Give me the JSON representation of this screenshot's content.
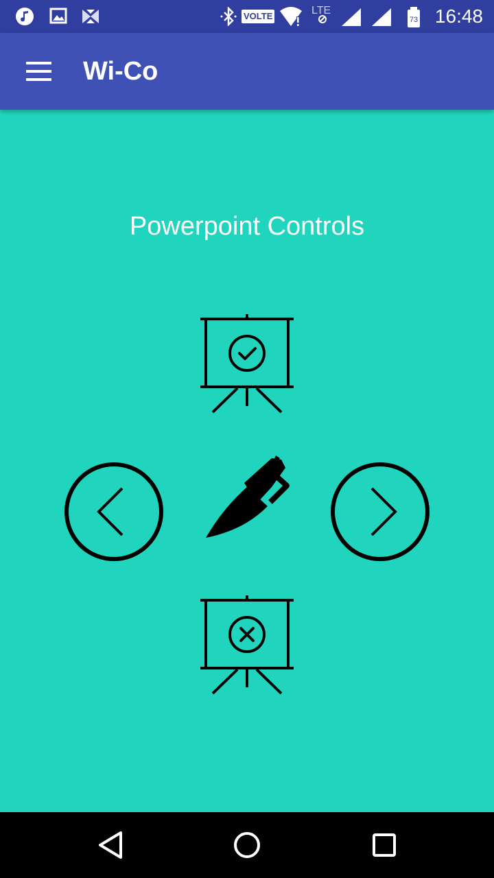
{
  "status_bar": {
    "time": "16:48",
    "volte_label": "VOLTE",
    "battery_level": "73",
    "icons": [
      "music-icon",
      "gallery-icon",
      "app-notification-icon",
      "bluetooth-icon",
      "volte-icon",
      "wifi-icon",
      "lte-icon",
      "signal-icon",
      "signal-icon",
      "battery-icon"
    ]
  },
  "app_bar": {
    "title": "Wi-Co",
    "menu_icon": "hamburger-menu-icon"
  },
  "main": {
    "heading": "Powerpoint Controls",
    "controls": [
      {
        "name": "start-presentation",
        "icon": "presentation-check-icon"
      },
      {
        "name": "previous-slide",
        "icon": "chevron-left-circle-icon"
      },
      {
        "name": "pen-tool",
        "icon": "pen-icon"
      },
      {
        "name": "next-slide",
        "icon": "chevron-right-circle-icon"
      },
      {
        "name": "stop-presentation",
        "icon": "presentation-close-icon"
      }
    ]
  },
  "nav_bar": {
    "buttons": [
      "back-icon",
      "home-icon",
      "recents-icon"
    ]
  },
  "colors": {
    "status_bar": "#303f9f",
    "app_bar": "#3f51b5",
    "background": "#21d4bd",
    "icon": "#000000"
  }
}
